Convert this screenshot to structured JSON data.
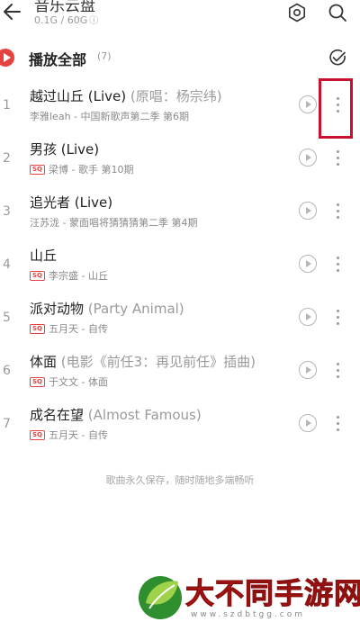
{
  "header": {
    "title": "音乐云盘",
    "storage": "0.1G / 60G",
    "storage_info_icon": "ⓘ",
    "icons": [
      "back-arrow-icon",
      "settings-icon",
      "search-icon"
    ]
  },
  "playall": {
    "label": "播放全部",
    "count": "(7)"
  },
  "songs": [
    {
      "index": "1",
      "title": "越过山丘 (Live)",
      "suffix": " (原唱：杨宗纬)",
      "sq": "",
      "meta": "李雅leah - 中国新歌声第二季 第6期"
    },
    {
      "index": "2",
      "title": "男孩 (Live)",
      "suffix": "",
      "sq": "SQ",
      "meta": "梁博 - 歌手 第10期"
    },
    {
      "index": "3",
      "title": "追光者 (Live)",
      "suffix": "",
      "sq": "",
      "meta": "汪苏泷 - 蒙面唱将猜猜猜第二季 第4期"
    },
    {
      "index": "4",
      "title": "山丘",
      "suffix": "",
      "sq": "SQ",
      "meta": "李宗盛 - 山丘"
    },
    {
      "index": "5",
      "title": "派对动物",
      "suffix": " (Party Animal)",
      "sq": "SQ",
      "meta": "五月天 - 自传"
    },
    {
      "index": "6",
      "title": "体面",
      "suffix": " (电影《前任3：再见前任》插曲)",
      "sq": "SQ",
      "meta": "于文文 - 体面"
    },
    {
      "index": "7",
      "title": "成名在望",
      "suffix": " (Almost Famous)",
      "sq": "SQ",
      "meta": "五月天 - 自传"
    }
  ],
  "footer_note": "歌曲永久保存，随时随地多端畅听",
  "watermark": {
    "title": "大不同手游网",
    "url": "www.szdbtgg.com"
  },
  "colors": {
    "accent": "#e8423f",
    "highlight_box": "#c8102e",
    "watermark_red": "#d81e1e"
  }
}
